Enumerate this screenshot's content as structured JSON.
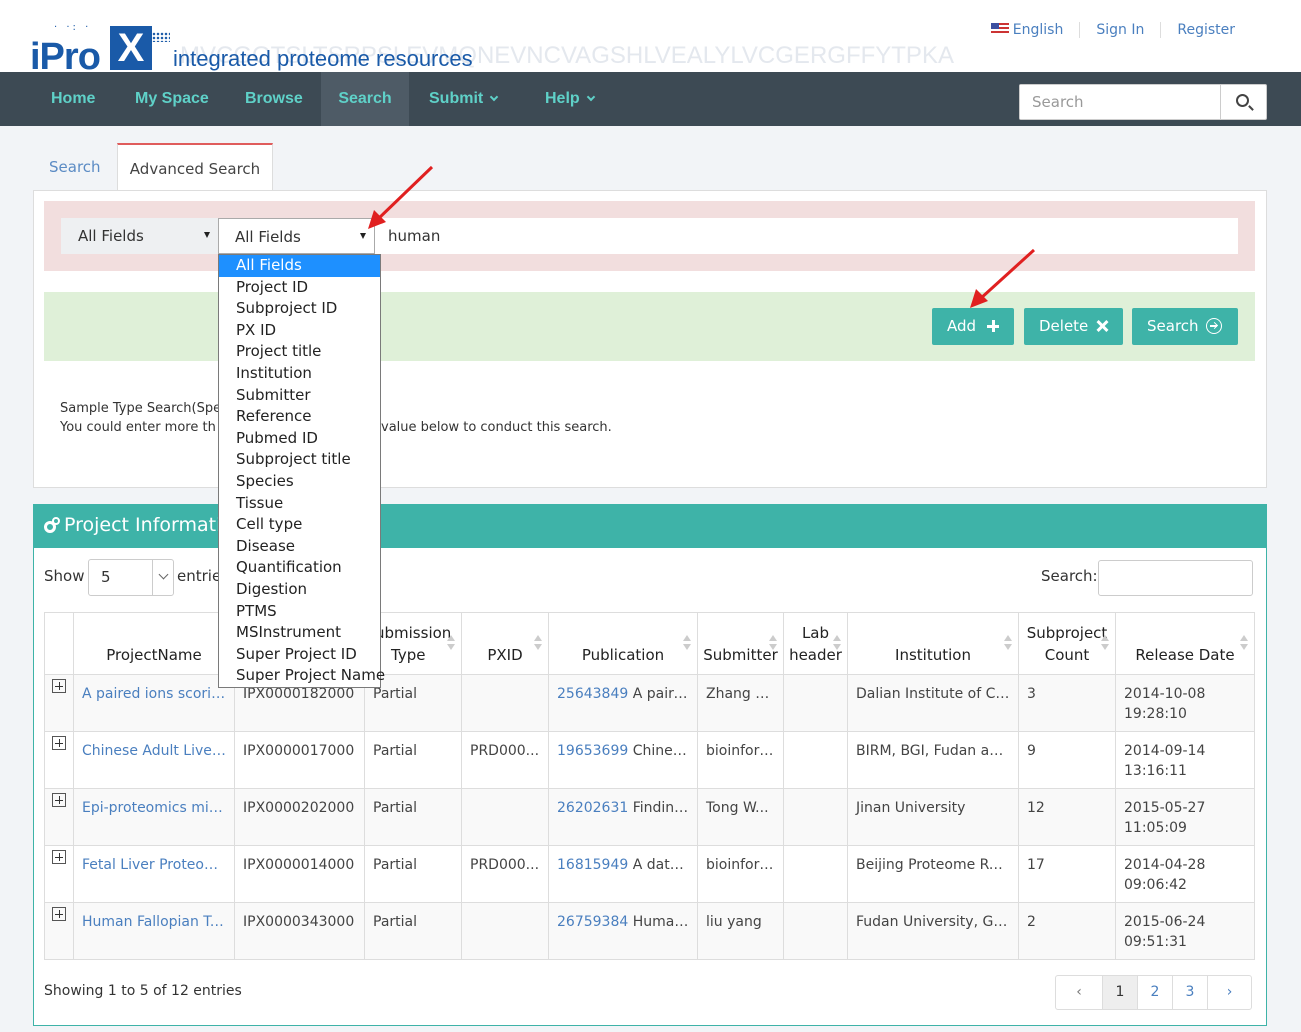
{
  "header": {
    "logo_text": "iPro",
    "logo_x": "X",
    "tagline": "integrated proteome resources",
    "watermark": "MVCGGTSLTSRPSLEVMQNEVNCVAGSHLVEALYLVCGERGFFYTPKA",
    "language": "English",
    "sign_in": "Sign In",
    "register": "Register"
  },
  "nav": {
    "items": [
      {
        "label": "Home"
      },
      {
        "label": "My Space"
      },
      {
        "label": "Browse"
      },
      {
        "label": "Search"
      },
      {
        "label": "Submit"
      },
      {
        "label": "Help"
      }
    ],
    "search_placeholder": "Search"
  },
  "tabs": {
    "search": "Search",
    "advanced": "Advanced Search"
  },
  "advanced": {
    "field1": "All Fields",
    "field2": "All Fields",
    "value": "human",
    "add": "Add",
    "delete": "Delete",
    "search": "Search",
    "hint_line1": "Sample Type Search(Spe",
    "hint_line2": "You could enter more th",
    "hint_line2_tail": "value below to conduct this search."
  },
  "dropdown": {
    "options": [
      "All Fields",
      "Project ID",
      "Subproject ID",
      "PX ID",
      "Project title",
      "Institution",
      "Submitter",
      "Reference",
      "Pubmed ID",
      "Subproject title",
      "Species",
      "Tissue",
      "Cell type",
      "Disease",
      "Quantification",
      "Digestion",
      "PTMS",
      "MSInstrument",
      "Super Project ID",
      "Super Project Name"
    ],
    "selected": "All Fields"
  },
  "project_panel": {
    "title": "Project Informati",
    "show_label": "Show",
    "page_size": "5",
    "entries_label": "entrie",
    "search_label": "Search:",
    "columns": [
      "ProjectName",
      "ubmission",
      "Type",
      "PXID",
      "Publication",
      "Submitter",
      "Lab",
      "header",
      "Institution",
      "Subproject",
      "Count",
      "Release Date"
    ],
    "rows": [
      {
        "name": "A paired ions scorin...",
        "id": "IPX0000182000",
        "type": "Partial",
        "pxid": "",
        "pmid": "25643849",
        "pub": " A paire...",
        "submitter": "Zhang S...",
        "lab": "",
        "institution": "Dalian Institute of Ch...",
        "count": "3",
        "date": "2014-10-08",
        "time": "19:28:10"
      },
      {
        "name": "Chinese Adult Liver ...",
        "id": "IPX0000017000",
        "type": "Partial",
        "pxid": "PRD000...",
        "pmid": "19653699",
        "pub": " Chines...",
        "submitter": "bioinfor ...",
        "lab": "",
        "institution": "BIRM, BGI, Fudan an...",
        "count": "9",
        "date": "2014-09-14",
        "time": "13:16:11"
      },
      {
        "name": "Epi-proteomics mis...",
        "id": "IPX0000202000",
        "type": "Partial",
        "pxid": "",
        "pmid": "26202631",
        "pub": " Finding ...",
        "submitter": "Tong W...",
        "lab": "",
        "institution": "Jinan University",
        "count": "12",
        "date": "2015-05-27",
        "time": "11:05:09"
      },
      {
        "name": "Fetal Liver Proteome",
        "id": "IPX0000014000",
        "type": "Partial",
        "pxid": "PRD000...",
        "pmid": "16815949",
        "pub": " A datas...",
        "submitter": "bioinfor ...",
        "lab": "",
        "institution": "Beijing Proteome Res...",
        "count": "17",
        "date": "2014-04-28",
        "time": "09:06:42"
      },
      {
        "name": "Human Fallopian Tu...",
        "id": "IPX0000343000",
        "type": "Partial",
        "pxid": "",
        "pmid": "26759384",
        "pub": " Human...",
        "submitter": "liu yang",
        "lab": "",
        "institution": "Fudan University, Gu...",
        "count": "2",
        "date": "2015-06-24",
        "time": "09:51:31"
      }
    ],
    "showing": "Showing 1 to 5 of 12 entries",
    "pages": [
      "1",
      "2",
      "3"
    ],
    "prev": "‹",
    "next": "›"
  },
  "colors": {
    "teal": "#3eb3a8",
    "nav_bg": "#3d4a54",
    "nav_text": "#5fd1c8",
    "brand_blue": "#1a5aa8",
    "annotation_arrow": "#e02020"
  }
}
